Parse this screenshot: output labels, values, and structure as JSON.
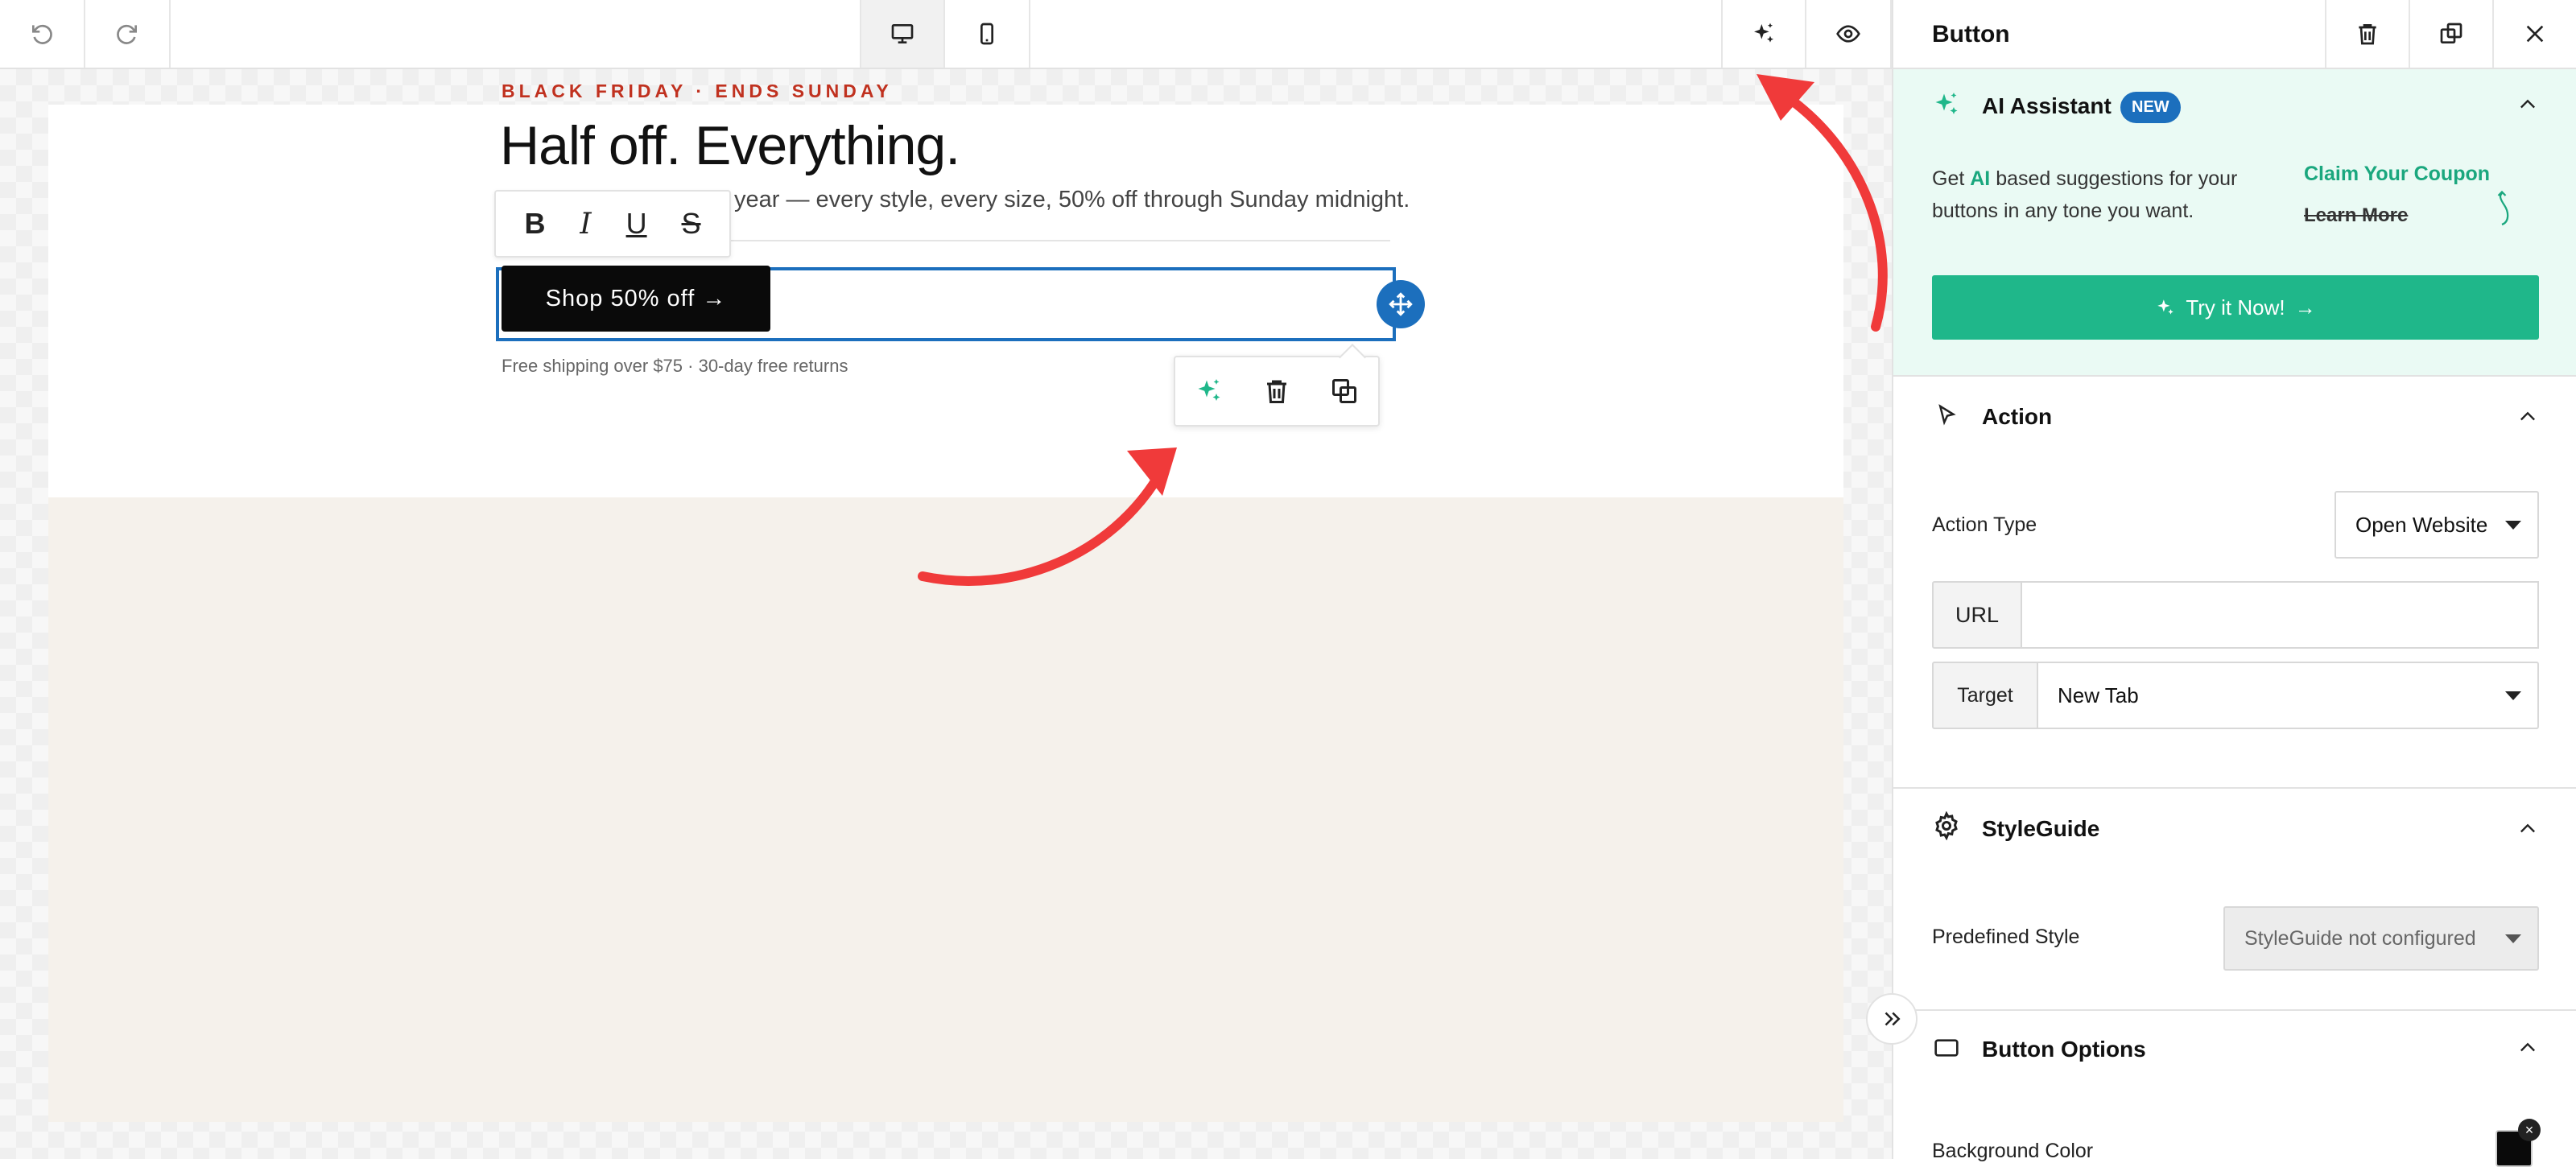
{
  "colors": {
    "accent": "#1c6fbd",
    "ai_green": "#1fb78a",
    "eyebrow_red": "#c0311f",
    "annotation_red": "#f03a3a",
    "cta_black": "#0a0a0a",
    "beige": "#f5f1eb"
  },
  "toolbar": {
    "undo_icon": "undo-icon",
    "redo_icon": "redo-icon",
    "desktop_icon": "desktop-icon",
    "mobile_icon": "mobile-icon",
    "ai_icon": "sparkle-icon",
    "preview_icon": "eye-icon"
  },
  "email": {
    "eyebrow": "BLACK FRIDAY · ENDS SUNDAY",
    "headline": "Half off. Everything.",
    "subtext": "year — every style, every size, 50% off through Sunday midnight.",
    "cta_label": "Shop 50% off →",
    "fineprint": "Free shipping over $75 · 30-day free returns"
  },
  "format_toolbar": {
    "bold": "B",
    "italic": "I",
    "underline": "U",
    "strike": "S"
  },
  "panel": {
    "title": "Button",
    "ai": {
      "title": "AI Assistant",
      "badge": "NEW",
      "desc_pre": "Get ",
      "desc_ai": "AI",
      "desc_post": " based suggestions for your buttons in any tone you want.",
      "claim": "Claim Your Coupon",
      "learn": "Learn More",
      "try_label": "Try it Now!"
    },
    "action": {
      "title": "Action",
      "type_label": "Action Type",
      "type_value": "Open Website",
      "url_label": "URL",
      "url_value": "",
      "target_label": "Target",
      "target_value": "New Tab"
    },
    "styleguide": {
      "title": "StyleGuide",
      "predefined_label": "Predefined Style",
      "predefined_value": "StyleGuide not configured"
    },
    "button_options": {
      "title": "Button Options",
      "bg_label": "Background Color",
      "bg_value": "#0a0a0a"
    }
  }
}
